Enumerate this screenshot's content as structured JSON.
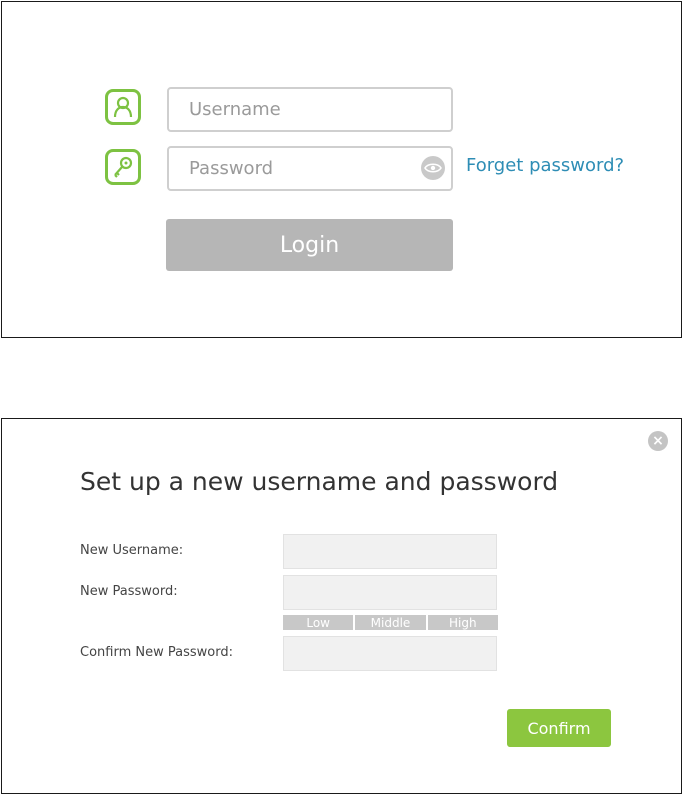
{
  "login": {
    "username_placeholder": "Username",
    "password_placeholder": "Password",
    "forget_password": "Forget password?",
    "login_label": "Login",
    "icons": [
      "user-icon",
      "key-icon",
      "eye-icon"
    ]
  },
  "setup": {
    "close_symbol": "×",
    "title": "Set up a new username and password",
    "new_username_label": "New Username:",
    "new_password_label": "New Password:",
    "confirm_password_label": "Confirm New Password:",
    "strength": [
      "Low",
      "Middle",
      "High"
    ],
    "confirm_label": "Confirm"
  },
  "colors": {
    "accent_green": "#7dc242",
    "confirm_green": "#8cc63f",
    "link_blue": "#2e8db5",
    "login_gray": "#b6b6b6"
  }
}
